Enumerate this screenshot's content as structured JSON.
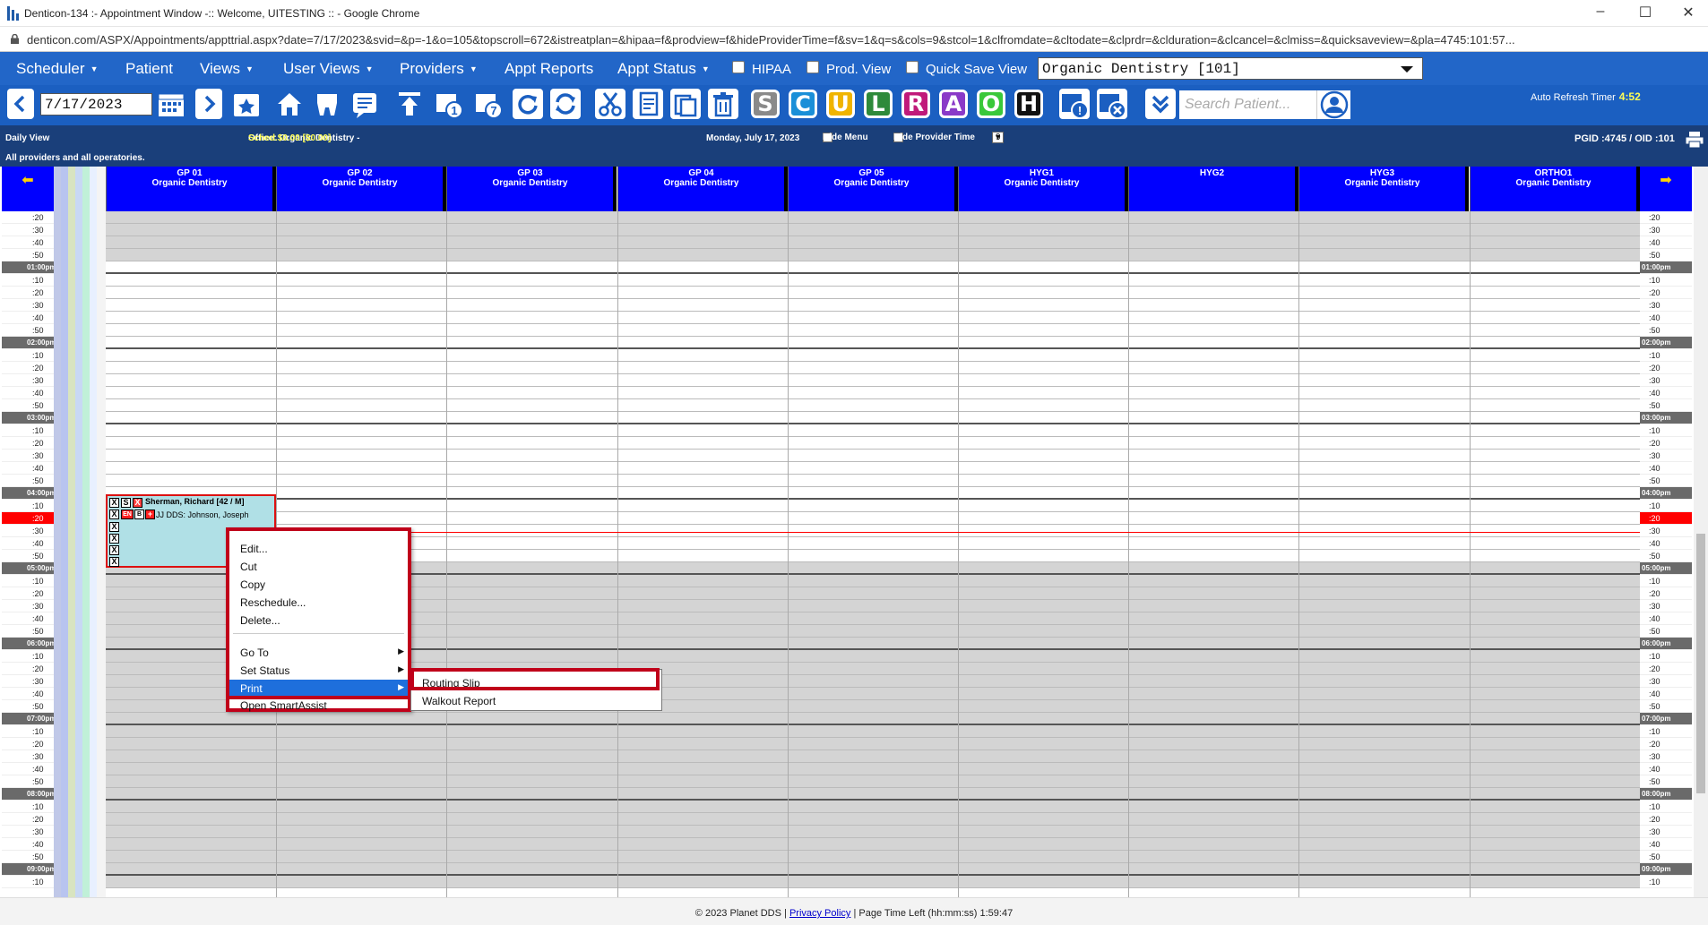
{
  "window": {
    "title": "Denticon-134 :- Appointment Window -:: Welcome, UITESTING :: - Google Chrome",
    "url": "denticon.com/ASPX/Appointments/appttrial.aspx?date=7/17/2023&svid=&p=-1&o=105&topscroll=672&istreatplan=&hipaa=f&prodview=f&hideProviderTime=f&sv=1&q=s&cols=9&stcol=1&clfromdate=&cltodate=&clprdr=&clduration=&clcancel=&clmiss=&quicksaveview=&pla=4745:101:57..."
  },
  "menu": {
    "scheduler": "Scheduler",
    "patient": "Patient",
    "views": "Views",
    "user_views": "User Views",
    "providers": "Providers",
    "appt_reports": "Appt Reports",
    "appt_status": "Appt Status",
    "hipaa": "HIPAA",
    "prod_view": "Prod. View",
    "quick_save": "Quick Save View",
    "office": "Organic Dentistry [101]"
  },
  "toolbar": {
    "date": "7/17/2023",
    "letters": [
      "S",
      "C",
      "U",
      "L",
      "R",
      "A",
      "O",
      "H"
    ],
    "letter_colors": [
      "#8a8a8a",
      "#1a8fd8",
      "#f0b400",
      "#2e8a3a",
      "#c01a7a",
      "#8a3ac8",
      "#3ac83a",
      "#111111"
    ],
    "search_placeholder": "Search Patient...",
    "refresh_label": "Auto Refresh Timer",
    "refresh_time": "4:52"
  },
  "info": {
    "daily_view": "Daily View",
    "office_label": "Office: Organic Dentistry -",
    "sched": "Sched.$0.00 [$0.00]",
    "date": "Monday, July 17, 2023",
    "hide_menu": "Hide Menu",
    "hide_provider": "Hide Provider Time",
    "cols": "9",
    "pgid": "PGID :4745  /  OID :101",
    "all_providers": "All providers and all operatories."
  },
  "columns": [
    {
      "op": "GP 01",
      "office": "Organic Dentistry"
    },
    {
      "op": "GP 02",
      "office": "Organic Dentistry"
    },
    {
      "op": "GP 03",
      "office": "Organic Dentistry"
    },
    {
      "op": "GP 04",
      "office": "Organic Dentistry"
    },
    {
      "op": "GP 05",
      "office": "Organic Dentistry"
    },
    {
      "op": "HYG1",
      "office": "Organic Dentistry"
    },
    {
      "op": "HYG2",
      "office": ""
    },
    {
      "op": "HYG3",
      "office": "Organic Dentistry"
    },
    {
      "op": "ORTHO1",
      "office": "Organic Dentistry"
    }
  ],
  "time_labels": [
    ":20",
    ":30",
    ":40",
    ":50",
    "01:00pm",
    ":10",
    ":20",
    ":30",
    ":40",
    ":50",
    "02:00pm",
    ":10",
    ":20",
    ":30",
    ":40",
    ":50",
    "03:00pm",
    ":10",
    ":20",
    ":30",
    ":40",
    ":50",
    "04:00pm",
    ":10",
    ":20",
    ":30",
    ":40",
    ":50",
    "05:00pm",
    ":10",
    ":20",
    ":30",
    ":40",
    ":50",
    "06:00pm",
    ":10",
    ":20",
    ":30",
    ":40",
    ":50",
    "07:00pm",
    ":10",
    ":20",
    ":30",
    ":40",
    ":50",
    "08:00pm",
    ":10",
    ":20",
    ":30",
    ":40",
    ":50",
    "09:00pm",
    ":10"
  ],
  "appointment": {
    "patient": "Sherman, Richard [42 / M]",
    "provider": "JJ DDS: Johnson, Joseph",
    "badges": [
      "X",
      "S",
      "X"
    ],
    "badges2": [
      "X",
      "EN",
      "B",
      "+"
    ]
  },
  "context_menu": {
    "items": [
      "Edit...",
      "Cut",
      "Copy",
      "Reschedule...",
      "Delete..."
    ],
    "goto": "Go To",
    "set_status": "Set Status",
    "print": "Print",
    "smartassist": "Open SmartAssist",
    "print_submenu": [
      "Routing Slip",
      "Walkout Report"
    ]
  },
  "footer": {
    "copyright": "© 2023 Planet DDS |",
    "privacy": "Privacy Policy",
    "time_left": "| Page Time Left (hh:mm:ss) 1:59:47"
  }
}
